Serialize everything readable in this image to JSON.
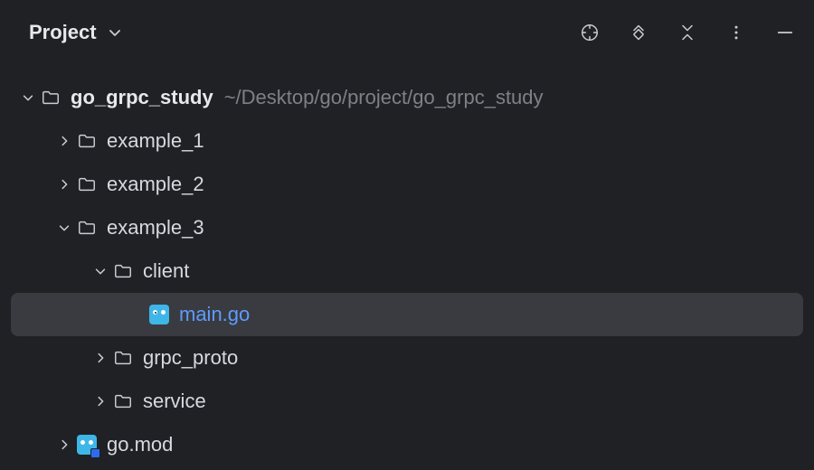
{
  "header": {
    "title": "Project"
  },
  "tree": {
    "root": {
      "name": "go_grpc_study",
      "hint": "~/Desktop/go/project/go_grpc_study"
    },
    "nodes": {
      "example_1": "example_1",
      "example_2": "example_2",
      "example_3": "example_3",
      "client": "client",
      "main_go": "main.go",
      "grpc_proto": "grpc_proto",
      "service": "service",
      "go_mod": "go.mod"
    }
  },
  "colors": {
    "background": "#1f2125",
    "selection": "#393b40",
    "link": "#5e9bff",
    "muted": "#7d8187"
  }
}
